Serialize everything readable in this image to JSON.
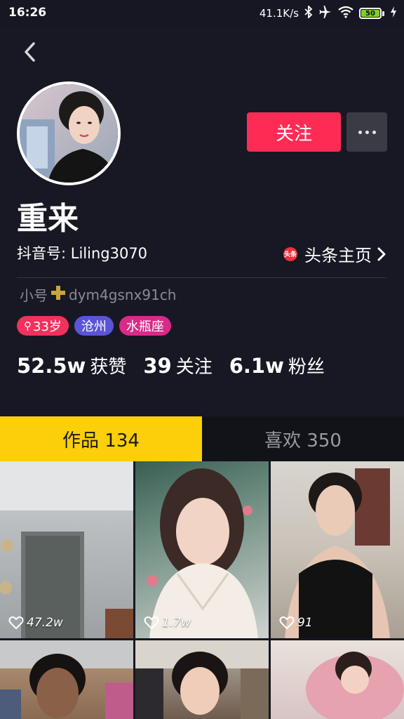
{
  "status_bar": {
    "time": "16:26",
    "network_speed": "41.1K/s",
    "battery": "50",
    "icons": [
      "bluetooth-icon",
      "airplane-icon",
      "wifi-icon",
      "battery-icon",
      "charging-icon"
    ]
  },
  "profile": {
    "nickname": "重来",
    "douyin_id": "抖音号: Liling3070",
    "toutiao_logo_text": "头条",
    "toutiao_link": "头条主页",
    "signature_prefix": "小号",
    "signature_suffix": "dym4gsnx91ch",
    "follow_label": "关注",
    "tags": {
      "age": "33岁",
      "city": "沧州",
      "zodiac": "水瓶座"
    },
    "stats": {
      "likes_num": "52.5w",
      "likes_label": "获赞",
      "following_num": "39",
      "following_label": "关注",
      "followers_num": "6.1w",
      "followers_label": "粉丝"
    }
  },
  "tabs": {
    "works": "作品 134",
    "likes": "喜欢 350"
  },
  "videos": [
    {
      "likes": "47.2w"
    },
    {
      "likes": "1.7w"
    },
    {
      "likes": "91"
    },
    {
      "likes": ""
    },
    {
      "likes": ""
    },
    {
      "likes": ""
    }
  ],
  "colors": {
    "background": "#171823",
    "follow_button": "#fe2c55",
    "active_tab": "#fccf0a",
    "tag_age": "#f0325d",
    "tag_city": "#5b54d6",
    "tag_zodiac": "#d92a87"
  }
}
